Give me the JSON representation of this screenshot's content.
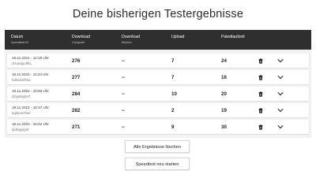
{
  "page": {
    "title": "Deine bisherigen Testergebnisse"
  },
  "table": {
    "headers": [
      {
        "label": "Datum",
        "sub": "Speedtest-ID"
      },
      {
        "label": "Download",
        "sub": "Computer"
      },
      {
        "label": "Download",
        "sub": "Modem"
      },
      {
        "label": "Upload",
        "sub": ""
      },
      {
        "label": "Paketlaufzeit",
        "sub": ""
      }
    ],
    "rows": [
      {
        "datetime": "18.11.2021 - 12:25 Uhr",
        "id": "ztzqwqqu9kq",
        "download_computer": "276",
        "download_modem": "--",
        "upload": "7",
        "latency": "24"
      },
      {
        "datetime": "18.11.2021 - 11:24 Uhr",
        "id": "hdtszdzifhhq",
        "download_computer": "277",
        "download_modem": "--",
        "upload": "7",
        "latency": "16"
      },
      {
        "datetime": "18.11.2021 - 10:50 Uhr",
        "id": "d2ypb5qbxrf",
        "download_computer": "284",
        "download_modem": "--",
        "upload": "10",
        "latency": "20"
      },
      {
        "datetime": "18.11.2021 - 10:47 Uhr",
        "id": "bgdrpnchlwe",
        "download_computer": "282",
        "download_modem": "--",
        "upload": "2",
        "latency": "19"
      },
      {
        "datetime": "18.11.2021 - 10:22 Uhr",
        "id": "bjdkrgyiglof",
        "download_computer": "271",
        "download_modem": "--",
        "upload": "9",
        "latency": "30"
      }
    ]
  },
  "buttons": {
    "delete_all": "Alle Ergebnisse löschen",
    "restart": "Speedtest neu starten"
  },
  "icons": {
    "delete": "trash-icon",
    "expand": "chevron-down-icon"
  }
}
